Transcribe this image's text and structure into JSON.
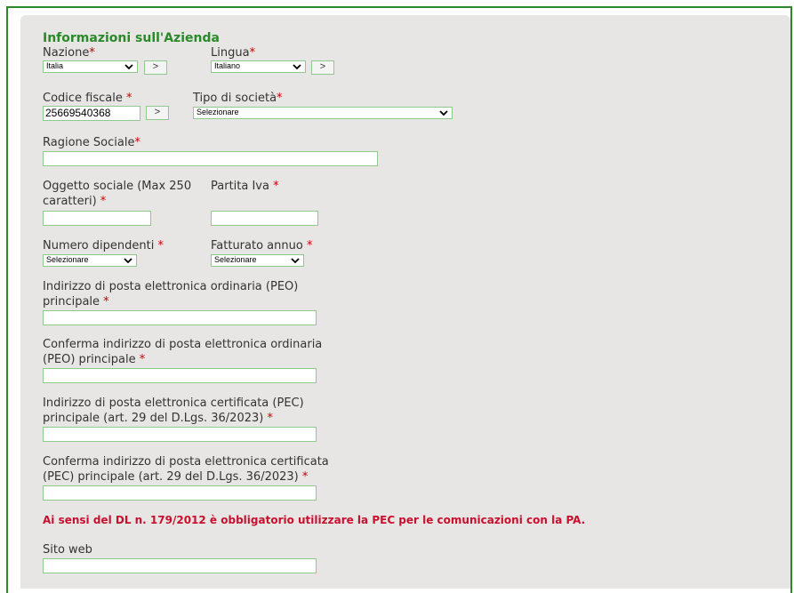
{
  "section": {
    "title": "Informazioni sull'Azienda"
  },
  "required_marker": "*",
  "nazione": {
    "label": "Nazione",
    "selected": "Italia",
    "next_label": ">"
  },
  "lingua": {
    "label": "Lingua",
    "selected": "Italiano",
    "next_label": ">"
  },
  "codice_fiscale": {
    "label": "Codice fiscale ",
    "value": "25669540368",
    "next_label": ">"
  },
  "tipo_societa": {
    "label": "Tipo di società",
    "selected": "Selezionare"
  },
  "ragione_sociale": {
    "label": "Ragione Sociale",
    "value": ""
  },
  "oggetto_sociale": {
    "label_line1": "Oggetto sociale (Max 250",
    "label_line2": "caratteri) ",
    "value": ""
  },
  "partita_iva": {
    "label": "Partita Iva ",
    "value": ""
  },
  "numero_dipendenti": {
    "label": "Numero dipendenti ",
    "selected": "Selezionare"
  },
  "fatturato_annuo": {
    "label": "Fatturato annuo ",
    "selected": "Selezionare"
  },
  "peo": {
    "label_line1": "Indirizzo di posta elettronica ordinaria (PEO)",
    "label_line2": "principale ",
    "value": ""
  },
  "peo_confirm": {
    "label_line1": "Conferma indirizzo di posta elettronica ordinaria",
    "label_line2": "(PEO) principale ",
    "value": ""
  },
  "pec": {
    "label_line1": "Indirizzo di posta elettronica certificata (PEC)",
    "label_line2": "principale (art. 29 del D.Lgs. 36/2023) ",
    "value": ""
  },
  "pec_confirm": {
    "label_line1": "Conferma indirizzo di posta elettronica certificata",
    "label_line2": "(PEC) principale (art. 29 del D.Lgs. 36/2023) ",
    "value": ""
  },
  "notice": "Ai sensi del DL n. 179/2012 è obbligatorio utilizzare la PEC per le comunicazioni con la PA.",
  "sito_web": {
    "label": "Sito web",
    "value": ""
  },
  "colors": {
    "accent_green": "#2a8a2a",
    "required_red": "#cc0000",
    "notice_red": "#c8102e",
    "panel_bg": "#e7e6e4",
    "field_border": "#8ec98e"
  },
  "icons": {
    "dropdown": "chevron-down-icon"
  }
}
